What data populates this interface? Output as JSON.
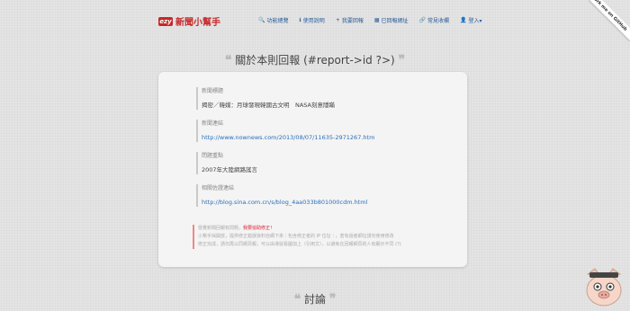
{
  "brand": {
    "logo": "ezy",
    "name": "新聞小幫手"
  },
  "nav": [
    {
      "icon": "search-icon",
      "glyph": "🔍",
      "label": "功能總覽"
    },
    {
      "icon": "info-icon",
      "glyph": "ℹ",
      "label": "使用說明"
    },
    {
      "icon": "plus-icon",
      "glyph": "+",
      "label": "我要回報"
    },
    {
      "icon": "grid-icon",
      "glyph": "▦",
      "label": "已回報網址"
    },
    {
      "icon": "link-icon",
      "glyph": "🔗",
      "label": "常見收欄"
    },
    {
      "icon": "user-icon",
      "glyph": "👤",
      "label": "登入▾"
    }
  ],
  "ribbon": "Fork me on GitHub",
  "report": {
    "title": "關於本則回報 (#report->id ?>)",
    "fields": [
      {
        "label": "新聞標題",
        "value": "揭密／韓媒：月球發現韓國古文明　NASA刻意隱瞞",
        "link": false
      },
      {
        "label": "新聞連結",
        "value": "http://www.nownews.com/2013/08/07/11635-2971267.htm",
        "link": true
      },
      {
        "label": "問題重點",
        "value": "2007年大陸網路謠言",
        "link": false
      },
      {
        "label": "相關佐證連結",
        "value": "http://blog.sina.com.cn/s/blog_4aa033b801000cdm.html",
        "link": true
      }
    ],
    "notice_lead": "發覺新聞回報有問題，",
    "notice_strong": "我要協助修正！",
    "notice_line2": "小幫手採開放，提供修正錯誤資料自網下來｜包含修正者的 IP 位址｜，若有過者網址請勿使用修改",
    "notice_line3": "修正完成，請勿再以同網頁報，可以由滑鼠看圖加上（引用文），以避免在回報網頁的人有顯示不同 (?)"
  },
  "discussion": {
    "title": "討論"
  }
}
